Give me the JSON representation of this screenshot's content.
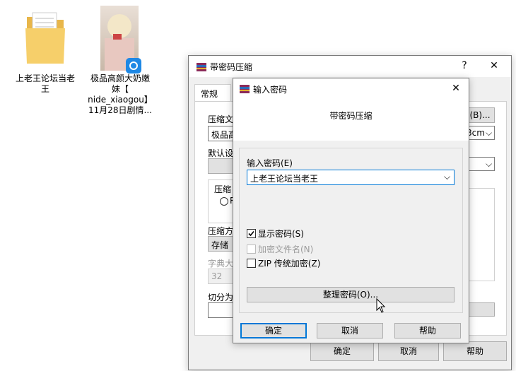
{
  "desktop": {
    "icons": [
      {
        "label": "上老王论坛当老\n王"
      },
      {
        "label": "极品高颜大奶嫩\n妹【\nnide_xiaogou】\n11月28日剧情..."
      }
    ]
  },
  "back_dialog": {
    "title": "带密码压缩",
    "help_glyph": "?",
    "close_glyph": "✕",
    "tab_general": "常规",
    "label_archive": "压缩文",
    "archive_value": "极品高",
    "browse_button": "(B)...",
    "split_suffix": "8cm",
    "label_default": "默认设",
    "label_format": "压缩",
    "radio_partial": "R",
    "label_method": "压缩方",
    "method_value": "存储",
    "label_dict": "字典大",
    "dict_value": "32",
    "label_split": "切分为",
    "ok": "确定",
    "cancel": "取消",
    "help": "帮助"
  },
  "front_dialog": {
    "title": "输入密码",
    "close_glyph": "✕",
    "heading": "带密码压缩",
    "label_password": "输入密码(E)",
    "password_value": "上老王论坛当老王",
    "show_password": "显示密码(S)",
    "encrypt_names": "加密文件名(N)",
    "zip_legacy": "ZIP 传统加密(Z)",
    "organize": "整理密码(O)...",
    "ok": "确定",
    "cancel": "取消",
    "help": "帮助"
  }
}
